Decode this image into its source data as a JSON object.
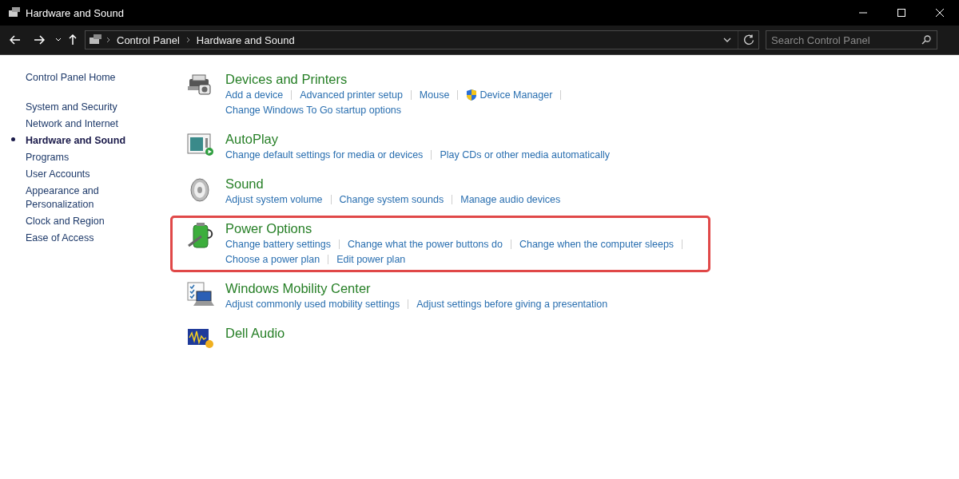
{
  "window": {
    "title": "Hardware and Sound"
  },
  "address_bar": {
    "breadcrumbs": [
      "Control Panel",
      "Hardware and Sound"
    ]
  },
  "search": {
    "placeholder": "Search Control Panel"
  },
  "sidebar": {
    "home": "Control Panel Home",
    "items": [
      {
        "label": "System and Security",
        "selected": false
      },
      {
        "label": "Network and Internet",
        "selected": false
      },
      {
        "label": "Hardware and Sound",
        "selected": true
      },
      {
        "label": "Programs",
        "selected": false
      },
      {
        "label": "User Accounts",
        "selected": false
      },
      {
        "label": "Appearance and Personalization",
        "selected": false
      },
      {
        "label": "Clock and Region",
        "selected": false
      },
      {
        "label": "Ease of Access",
        "selected": false
      }
    ]
  },
  "sections": [
    {
      "title": "Devices and Printers",
      "kind": "devices",
      "highlighted": false,
      "link_rows": [
        [
          {
            "text": "Add a device",
            "shield": false
          },
          {
            "text": "Advanced printer setup",
            "shield": false
          },
          {
            "text": "Mouse",
            "shield": false
          },
          {
            "text": "Device Manager",
            "shield": true
          }
        ],
        [
          {
            "text": "Change Windows To Go startup options",
            "shield": false
          }
        ]
      ]
    },
    {
      "title": "AutoPlay",
      "kind": "autoplay",
      "highlighted": false,
      "link_rows": [
        [
          {
            "text": "Change default settings for media or devices",
            "shield": false
          },
          {
            "text": "Play CDs or other media automatically",
            "shield": false
          }
        ]
      ]
    },
    {
      "title": "Sound",
      "kind": "sound",
      "highlighted": false,
      "link_rows": [
        [
          {
            "text": "Adjust system volume",
            "shield": false
          },
          {
            "text": "Change system sounds",
            "shield": false
          },
          {
            "text": "Manage audio devices",
            "shield": false
          }
        ]
      ]
    },
    {
      "title": "Power Options",
      "kind": "power",
      "highlighted": true,
      "link_rows": [
        [
          {
            "text": "Change battery settings",
            "shield": false
          },
          {
            "text": "Change what the power buttons do",
            "shield": false
          },
          {
            "text": "Change when the computer sleeps",
            "shield": false
          }
        ],
        [
          {
            "text": "Choose a power plan",
            "shield": false
          },
          {
            "text": "Edit power plan",
            "shield": false
          }
        ]
      ]
    },
    {
      "title": "Windows Mobility Center",
      "kind": "mobility",
      "highlighted": false,
      "link_rows": [
        [
          {
            "text": "Adjust commonly used mobility settings",
            "shield": false
          },
          {
            "text": "Adjust settings before giving a presentation",
            "shield": false
          }
        ]
      ]
    },
    {
      "title": "Dell Audio",
      "kind": "audio",
      "highlighted": false
    }
  ]
}
